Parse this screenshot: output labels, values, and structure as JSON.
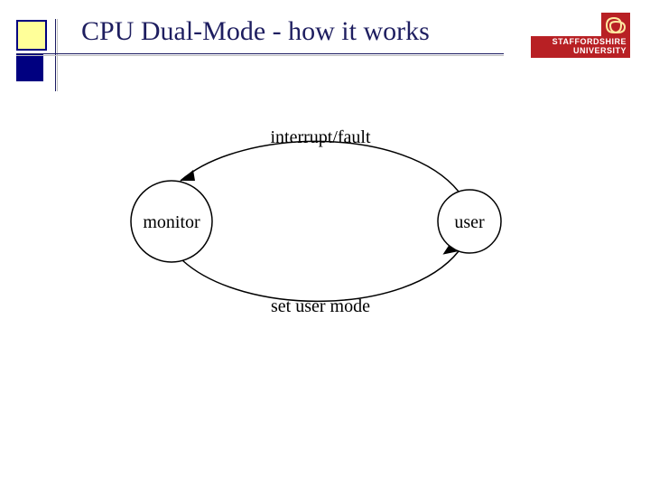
{
  "title": "CPU Dual-Mode - how it works",
  "logo": {
    "line1": "STAFFORDSHIRE",
    "line2": "UNIVERSITY",
    "icon_name": "staffordshire-knot-icon"
  },
  "diagram": {
    "left_node": "monitor",
    "right_node": "user",
    "top_arrow_label": "interrupt/fault",
    "bottom_arrow_label": "set user mode"
  }
}
